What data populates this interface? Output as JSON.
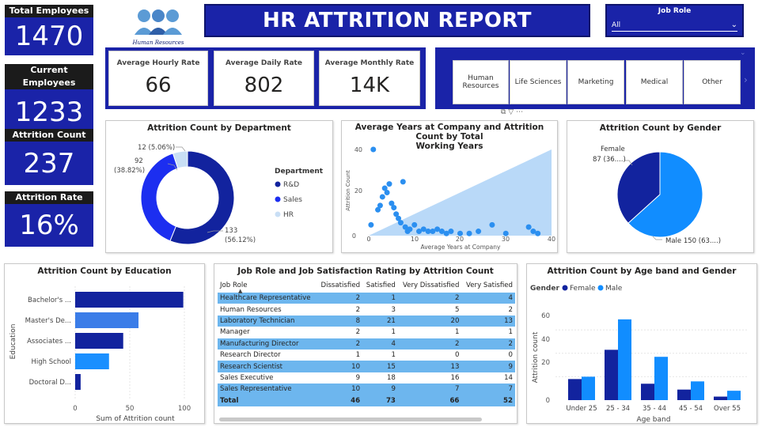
{
  "kpis": [
    {
      "label": "Total Employees",
      "value": "1470"
    },
    {
      "label": "Current Employees",
      "value": "1233"
    },
    {
      "label": "Attrition Count",
      "value": "237"
    },
    {
      "label": "Attrition Rate",
      "value": "16%"
    }
  ],
  "logo_caption": "Human Resources",
  "report_title": "HR ATTRITION REPORT",
  "job_role_filter": {
    "label": "Job Role",
    "value": "All"
  },
  "rates": [
    {
      "label": "Average Hourly Rate",
      "value": "66"
    },
    {
      "label": "Average Daily Rate",
      "value": "802"
    },
    {
      "label": "Average Monthly Rate",
      "value": "14K"
    }
  ],
  "education_field_slicer": {
    "options": [
      "Human Resources",
      "Life Sciences",
      "Marketing",
      "Medical",
      "Other"
    ]
  },
  "colors": {
    "navy": "#1a23a8",
    "dark_blue": "#12239e",
    "bright_blue": "#118dff",
    "light_blue": "#b9d9f8",
    "highlight": "#6db6ee"
  },
  "charts": {
    "department": {
      "title": "Attrition Count by Department",
      "legend_title": "Department",
      "label_hr": "12 (5.06%)",
      "label_sales_1": "92",
      "label_sales_2": "(38.82%)",
      "label_rd_1": "133",
      "label_rd_2": "(56.12%)"
    },
    "years": {
      "title_line1": "Average Years at Company and Attrition Count by Total",
      "title_line2": "Working Years",
      "xlabel": "Average Years at Company",
      "ylabel": "Attrition Count",
      "x_ticks": [
        "0",
        "10",
        "20",
        "30",
        "40"
      ],
      "y_ticks": [
        "0",
        "20",
        "40"
      ]
    },
    "gender": {
      "title": "Attrition Count by Gender",
      "label_female_1": "Female",
      "label_female_2": "87 (36....)",
      "label_male": "Male 150 (63....)"
    },
    "education": {
      "title": "Attrition Count by Education",
      "ylabel": "Education",
      "xlabel": "Sum of Attrition count",
      "x_ticks": [
        "0",
        "50",
        "100"
      ]
    },
    "job_table": {
      "title": "Job Role and Job Satisfaction Rating by Attrition Count",
      "columns": [
        "Job Role",
        "Dissatisfied",
        "Satisfied",
        "Very Dissatisfied",
        "Very Satisfied"
      ],
      "rows": [
        [
          "Healthcare Representative",
          "2",
          "1",
          "2",
          "4"
        ],
        [
          "Human Resources",
          "2",
          "3",
          "5",
          "2"
        ],
        [
          "Laboratory Technician",
          "8",
          "21",
          "20",
          "13"
        ],
        [
          "Manager",
          "2",
          "1",
          "1",
          "1"
        ],
        [
          "Manufacturing Director",
          "2",
          "4",
          "2",
          "2"
        ],
        [
          "Research Director",
          "1",
          "1",
          "0",
          "0"
        ],
        [
          "Research Scientist",
          "10",
          "15",
          "13",
          "9"
        ],
        [
          "Sales Executive",
          "9",
          "18",
          "16",
          "14"
        ],
        [
          "Sales Representative",
          "10",
          "9",
          "7",
          "7"
        ]
      ],
      "total": [
        "Total",
        "46",
        "73",
        "66",
        "52"
      ]
    },
    "ageband": {
      "title": "Attrition Count by Age band and Gender",
      "legend_title": "Gender",
      "xlabel": "Age band",
      "ylabel": "Attrition count",
      "y_ticks": [
        "0",
        "20",
        "40",
        "60"
      ]
    }
  },
  "chart_data": [
    {
      "type": "pie",
      "title": "Attrition Count by Department",
      "categories": [
        "R&D",
        "Sales",
        "HR"
      ],
      "values": [
        133,
        92,
        12
      ],
      "colors": [
        "#12239e",
        "#1c2ef0",
        "#c9dff5"
      ],
      "legend": "right"
    },
    {
      "type": "scatter",
      "title": "Average Years at Company and Attrition Count by Total Working Years",
      "xlabel": "Average Years at Company",
      "ylabel": "Attrition Count",
      "xlim": [
        0,
        40
      ],
      "ylim": [
        0,
        40
      ],
      "points": [
        [
          0.5,
          5
        ],
        [
          1,
          40
        ],
        [
          2,
          12
        ],
        [
          2.5,
          14
        ],
        [
          3,
          18
        ],
        [
          3.5,
          22
        ],
        [
          4,
          20
        ],
        [
          4.5,
          24
        ],
        [
          5,
          15
        ],
        [
          5.5,
          13
        ],
        [
          6,
          10
        ],
        [
          6.5,
          8
        ],
        [
          7,
          6
        ],
        [
          7.5,
          25
        ],
        [
          8,
          4
        ],
        [
          8.5,
          2
        ],
        [
          9,
          3
        ],
        [
          10,
          5
        ],
        [
          11,
          2
        ],
        [
          12,
          3
        ],
        [
          13,
          2
        ],
        [
          14,
          2
        ],
        [
          15,
          3
        ],
        [
          16,
          2
        ],
        [
          17,
          1
        ],
        [
          18,
          2
        ],
        [
          20,
          1
        ],
        [
          22,
          1
        ],
        [
          24,
          2
        ],
        [
          27,
          5
        ],
        [
          30,
          1
        ],
        [
          35,
          4
        ],
        [
          36,
          2
        ],
        [
          37,
          1
        ]
      ]
    },
    {
      "type": "pie",
      "title": "Attrition Count by Gender",
      "categories": [
        "Female",
        "Male"
      ],
      "values": [
        87,
        150
      ],
      "colors": [
        "#12239e",
        "#118dff"
      ]
    },
    {
      "type": "bar",
      "title": "Attrition Count by Education",
      "orientation": "horizontal",
      "categories": [
        "Bachelor's ...",
        "Master's De...",
        "Associates ...",
        "High School",
        "Doctoral D..."
      ],
      "values": [
        99,
        58,
        44,
        31,
        5
      ],
      "colors": [
        "#12239e",
        "#3b7de8",
        "#12239e",
        "#1a8fff",
        "#12239e"
      ],
      "xlabel": "Sum of Attrition count",
      "ylabel": "Education",
      "xlim": [
        0,
        100
      ]
    },
    {
      "type": "bar",
      "title": "Attrition Count by Age band and Gender",
      "categories": [
        "Under 25",
        "25 - 34",
        "35 - 44",
        "45 - 54",
        "Over 55"
      ],
      "series": [
        {
          "name": "Female",
          "values": [
            18,
            43,
            14,
            9,
            3
          ],
          "color": "#12239e"
        },
        {
          "name": "Male",
          "values": [
            20,
            69,
            37,
            16,
            8
          ],
          "color": "#118dff"
        }
      ],
      "xlabel": "Age band",
      "ylabel": "Attrition count",
      "ylim": [
        0,
        70
      ]
    },
    {
      "type": "table",
      "title": "Job Role and Job Satisfaction Rating by Attrition Count",
      "columns": [
        "Job Role",
        "Dissatisfied",
        "Satisfied",
        "Very Dissatisfied",
        "Very Satisfied"
      ],
      "rows": [
        [
          "Healthcare Representative",
          2,
          1,
          2,
          4
        ],
        [
          "Human Resources",
          2,
          3,
          5,
          2
        ],
        [
          "Laboratory Technician",
          8,
          21,
          20,
          13
        ],
        [
          "Manager",
          2,
          1,
          1,
          1
        ],
        [
          "Manufacturing Director",
          2,
          4,
          2,
          2
        ],
        [
          "Research Director",
          1,
          1,
          0,
          0
        ],
        [
          "Research Scientist",
          10,
          15,
          13,
          9
        ],
        [
          "Sales Executive",
          9,
          18,
          16,
          14
        ],
        [
          "Sales Representative",
          10,
          9,
          7,
          7
        ],
        [
          "Total",
          46,
          73,
          66,
          52
        ]
      ]
    }
  ]
}
